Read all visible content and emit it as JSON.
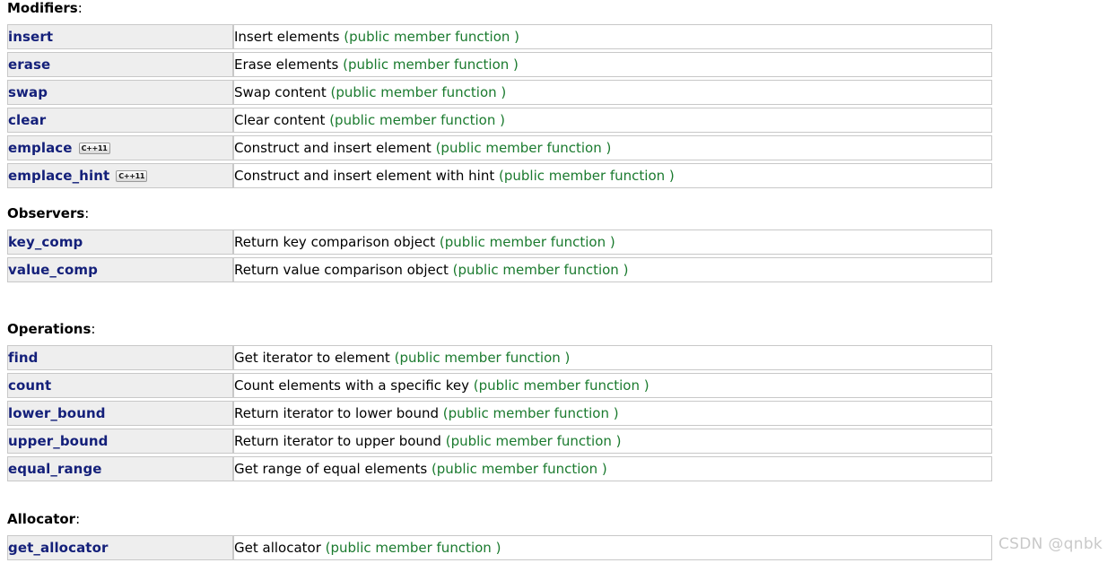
{
  "colors": {
    "member_link": "#14207a",
    "kind_text": "#1a7a2e",
    "name_cell_bg": "#eeeeee",
    "row_border": "#c8c8c8",
    "watermark": "#c9c9c9"
  },
  "badge": {
    "label": "C++11"
  },
  "sections": [
    {
      "title": "Modifiers",
      "colon": ":",
      "rows": [
        {
          "name": "insert",
          "badge": false,
          "desc": "Insert elements ",
          "kind": "(public member function )"
        },
        {
          "name": "erase",
          "badge": false,
          "desc": "Erase elements ",
          "kind": "(public member function )"
        },
        {
          "name": "swap",
          "badge": false,
          "desc": "Swap content ",
          "kind": "(public member function )"
        },
        {
          "name": "clear",
          "badge": false,
          "desc": "Clear content ",
          "kind": "(public member function )"
        },
        {
          "name": "emplace",
          "badge": true,
          "desc": "Construct and insert element ",
          "kind": "(public member function )"
        },
        {
          "name": "emplace_hint",
          "badge": true,
          "desc": "Construct and insert element with hint ",
          "kind": "(public member function )"
        }
      ]
    },
    {
      "title": "Observers",
      "colon": ":",
      "rows": [
        {
          "name": "key_comp",
          "badge": false,
          "desc": "Return key comparison object ",
          "kind": "(public member function )"
        },
        {
          "name": "value_comp",
          "badge": false,
          "desc": "Return value comparison object ",
          "kind": "(public member function )"
        }
      ]
    },
    {
      "title": "Operations",
      "colon": ":",
      "rows": [
        {
          "name": "find",
          "badge": false,
          "desc": "Get iterator to element ",
          "kind": "(public member function )"
        },
        {
          "name": "count",
          "badge": false,
          "desc": "Count elements with a specific key ",
          "kind": "(public member function )"
        },
        {
          "name": "lower_bound",
          "badge": false,
          "desc": "Return iterator to lower bound ",
          "kind": "(public member function )"
        },
        {
          "name": "upper_bound",
          "badge": false,
          "desc": "Return iterator to upper bound ",
          "kind": "(public member function )"
        },
        {
          "name": "equal_range",
          "badge": false,
          "desc": "Get range of equal elements ",
          "kind": "(public member function )"
        }
      ]
    },
    {
      "title": "Allocator",
      "colon": ":",
      "rows": [
        {
          "name": "get_allocator",
          "badge": false,
          "desc": "Get allocator ",
          "kind": "(public member function )"
        }
      ]
    }
  ],
  "watermark": {
    "text": "CSDN @qnbk"
  }
}
